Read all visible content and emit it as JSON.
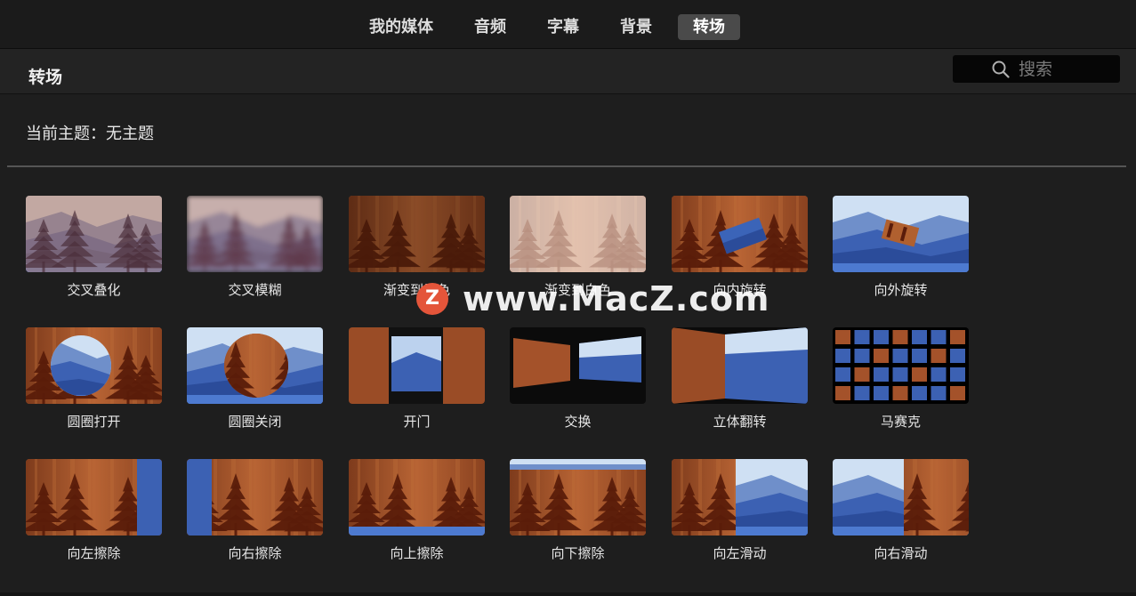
{
  "tabs": [
    {
      "label": "我的媒体",
      "active": false
    },
    {
      "label": "音频",
      "active": false
    },
    {
      "label": "字幕",
      "active": false
    },
    {
      "label": "背景",
      "active": false
    },
    {
      "label": "转场",
      "active": true
    }
  ],
  "header": {
    "title": "转场"
  },
  "search": {
    "placeholder": "搜索",
    "icon": "search-icon"
  },
  "theme": {
    "text": "当前主题：无主题"
  },
  "transitions": [
    {
      "label": "交叉叠化",
      "style": "cross-dissolve"
    },
    {
      "label": "交叉模糊",
      "style": "cross-blur"
    },
    {
      "label": "渐变到黑色",
      "style": "fade-black"
    },
    {
      "label": "渐变到白色",
      "style": "fade-white"
    },
    {
      "label": "向内旋转",
      "style": "spin-in"
    },
    {
      "label": "向外旋转",
      "style": "spin-out"
    },
    {
      "label": "圆圈打开",
      "style": "circle-open"
    },
    {
      "label": "圆圈关闭",
      "style": "circle-close"
    },
    {
      "label": "开门",
      "style": "doorway"
    },
    {
      "label": "交换",
      "style": "swap"
    },
    {
      "label": "立体翻转",
      "style": "cube"
    },
    {
      "label": "马赛克",
      "style": "mosaic"
    },
    {
      "label": "向左擦除",
      "style": "wipe-left"
    },
    {
      "label": "向右擦除",
      "style": "wipe-right"
    },
    {
      "label": "向上擦除",
      "style": "wipe-up"
    },
    {
      "label": "向下擦除",
      "style": "wipe-down"
    },
    {
      "label": "向左滑动",
      "style": "slide-left"
    },
    {
      "label": "向右滑动",
      "style": "slide-right"
    }
  ],
  "watermark": {
    "logo": "Z",
    "text": "www.MacZ.com"
  },
  "colors": {
    "background": "#1e1e1e",
    "active_tab": "#4a4a4a",
    "wood": "#a4522a",
    "mountain_blue": "#3b64b8",
    "watermark_logo": "#e4553a"
  }
}
